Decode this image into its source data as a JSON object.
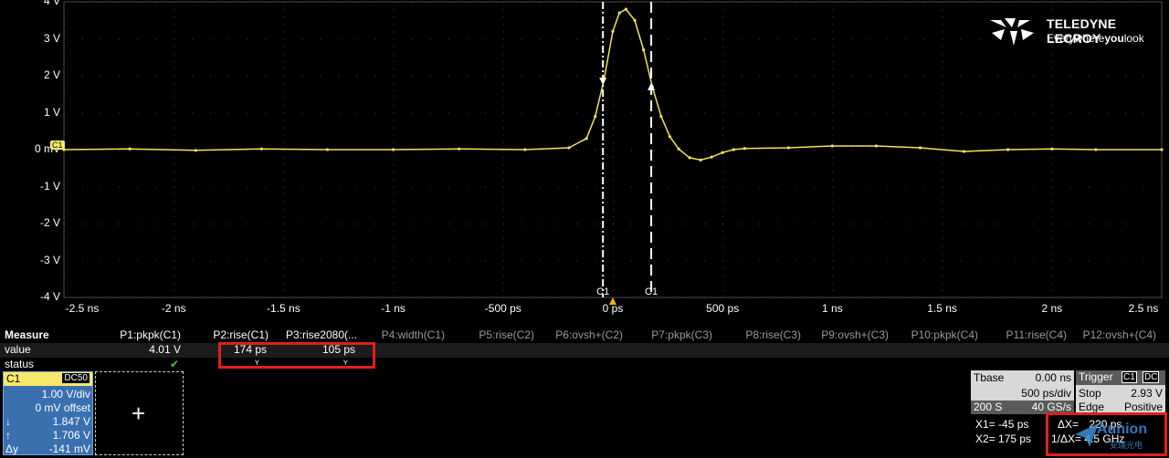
{
  "scope": {
    "y_labels": [
      "4 V",
      "3 V",
      "2 V",
      "1 V",
      "0 mV",
      "-1 V",
      "-2 V",
      "-3 V",
      "-4 V"
    ],
    "x_labels": [
      "-2.5 ns",
      "-2 ns",
      "-1.5 ns",
      "-1 ns",
      "-500 ps",
      "0 ps",
      "500 ps",
      "1 ns",
      "1.5 ns",
      "2 ns",
      "2.5 ns"
    ],
    "channel_tag": "C1",
    "cursor_labels": [
      "C1",
      "C1"
    ],
    "trace_color": "#f2e35a",
    "grid_color": "#444444",
    "cursor_x1_ns": -0.045,
    "cursor_x2_ns": 0.175,
    "cursor_x1_level_v": 1.847,
    "cursor_x2_level_v": 1.706
  },
  "logo": {
    "brand": "TELEDYNE LECROY",
    "tag_pre": "Everywhere",
    "tag_bold": "you",
    "tag_post": "look"
  },
  "chart_data": {
    "type": "line",
    "title": "",
    "xlabel": "",
    "ylabel": "",
    "xlim": [
      -2.5,
      2.5
    ],
    "ylim": [
      -4,
      4
    ],
    "x_unit": "ns",
    "y_unit": "V",
    "series": [
      {
        "x": [
          -2.5,
          -2.2,
          -1.9,
          -1.6,
          -1.3,
          -1.0,
          -0.7,
          -0.4,
          -0.2,
          -0.12,
          -0.08,
          -0.04,
          0.0,
          0.03,
          0.06,
          0.1,
          0.14,
          0.18,
          0.22,
          0.26,
          0.3,
          0.35,
          0.4,
          0.45,
          0.5,
          0.55,
          0.6,
          0.8,
          1.0,
          1.2,
          1.4,
          1.6,
          1.8,
          2.0,
          2.2,
          2.5
        ],
        "y": [
          0.0,
          0.02,
          -0.02,
          0.02,
          0.0,
          0.0,
          0.02,
          0.0,
          0.05,
          0.3,
          0.9,
          1.9,
          3.2,
          3.7,
          3.8,
          3.5,
          2.7,
          1.7,
          0.9,
          0.35,
          0.02,
          -0.22,
          -0.28,
          -0.2,
          -0.08,
          0.0,
          0.03,
          0.05,
          0.1,
          0.1,
          0.05,
          -0.05,
          0.0,
          0.02,
          0.0,
          0.0
        ]
      }
    ]
  },
  "measure": {
    "title": "Measure",
    "row_value_label": "value",
    "row_status_label": "status",
    "params": [
      {
        "name": "P1:pkpk(C1)",
        "value": "4.01 V",
        "status": "✔",
        "active": true
      },
      {
        "name": "P2:rise(C1)",
        "value": "174 ps",
        "status": "ʏ",
        "active": true
      },
      {
        "name": "P3:rise2080(...",
        "value": "105 ps",
        "status": "ʏ",
        "active": true
      },
      {
        "name": "P4:width(C1)",
        "value": "",
        "status": "",
        "active": false
      },
      {
        "name": "P5:rise(C2)",
        "value": "",
        "status": "",
        "active": false
      },
      {
        "name": "P6:ovsh+(C2)",
        "value": "",
        "status": "",
        "active": false
      },
      {
        "name": "P7:pkpk(C3)",
        "value": "",
        "status": "",
        "active": false
      },
      {
        "name": "P8:rise(C3)",
        "value": "",
        "status": "",
        "active": false
      },
      {
        "name": "P9:ovsh+(C3)",
        "value": "",
        "status": "",
        "active": false
      },
      {
        "name": "P10:pkpk(C4)",
        "value": "",
        "status": "",
        "active": false
      },
      {
        "name": "P11:rise(C4)",
        "value": "",
        "status": "",
        "active": false
      },
      {
        "name": "P12:ovsh+(C4)",
        "value": "",
        "status": "",
        "active": false
      }
    ]
  },
  "c1": {
    "name": "C1",
    "coupling": "DC50",
    "vdiv": "1.00 V/div",
    "offset": "0 mV offset",
    "level1": "1.847 V",
    "level2": "1.706 V",
    "dy_label": "Δy",
    "dy": "-141 mV"
  },
  "add_trace_icon": "plus-icon",
  "tbase": {
    "label": "Tbase",
    "delay": "0.00 ns",
    "tdiv": "500 ps/div",
    "samples": "200 S",
    "rate": "40 GS/s"
  },
  "trigger": {
    "label": "Trigger",
    "ch": "C1",
    "coupling": "DC",
    "mode": "Stop",
    "level": "2.93 V",
    "type": "Edge",
    "slope": "Positive"
  },
  "cursors": {
    "x1_label": "X1=",
    "x1_value": "-45 ps",
    "x2_label": "X2=",
    "x2_value": "175 ps",
    "dx_label": "ΔX=",
    "dx_value": "220 ps",
    "inv_dx_label": "1/ΔX=",
    "inv_dx_value": "4.5 GHz"
  },
  "watermark": {
    "text": "Aunion",
    "sub": "安瑞光电"
  }
}
